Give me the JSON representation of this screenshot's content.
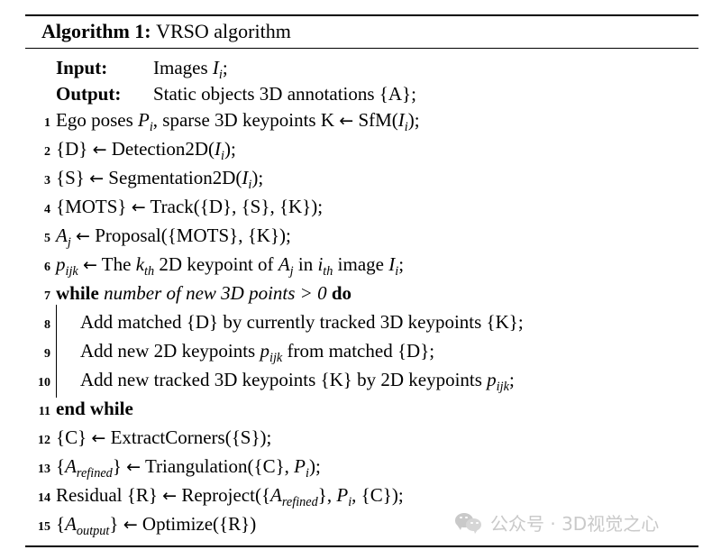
{
  "algorithm": {
    "caption_label": "Algorithm 1:",
    "caption_title": "VRSO algorithm",
    "io": [
      {
        "key": "Input:",
        "text_parts": [
          "Images ",
          "I",
          "i",
          ";"
        ]
      },
      {
        "key": "Output:",
        "text": "Static objects 3D annotations {A};"
      }
    ],
    "input_label": "Input:",
    "input_value": "Images Iᵢ;",
    "output_label": "Output:",
    "output_value": "Static objects 3D annotations {A};",
    "lines": [
      {
        "no": "1",
        "text": "Ego poses Pᵢ, sparse 3D keypoints K ← SfM(Iᵢ);"
      },
      {
        "no": "2",
        "text": "{D} ← Detection2D(Iᵢ);"
      },
      {
        "no": "3",
        "text": "{S} ← Segmentation2D(Iᵢ);"
      },
      {
        "no": "4",
        "text": "{MOTS} ← Track({D}, {S}, {K});"
      },
      {
        "no": "5",
        "text": "Aⱼ ← Proposal({MOTS}, {K});"
      },
      {
        "no": "6",
        "text": "pᵢⱼₖ ← The kₜₕ 2D keypoint of Aⱼ in iₜₕ image Iᵢ;"
      },
      {
        "no": "7",
        "text": "while number of new 3D points > 0 do"
      },
      {
        "no": "8",
        "text": "Add matched {D} by currently tracked 3D keypoints {K};"
      },
      {
        "no": "9",
        "text": "Add new 2D keypoints pᵢⱼₖ from matched {D};"
      },
      {
        "no": "10",
        "text": "Add new tracked 3D keypoints {K} by 2D keypoints pᵢⱼₖ;"
      },
      {
        "no": "11",
        "text": "end while"
      },
      {
        "no": "12",
        "text": "{C} ← ExtractCorners({S});"
      },
      {
        "no": "13",
        "text": "{Aᵣₑғᵢₙₑᵈ} ← Triangulation({C}, Pᵢ);"
      },
      {
        "no": "14",
        "text": "Residual {R} ← Reproject({Aᵣₑғᵢₙₑᵈ}, Pᵢ, {C});"
      },
      {
        "no": "15",
        "text": "{Aₒᵤₜₚᵤₜ} ← Optimize({R})"
      }
    ],
    "tokens": {
      "n1": "1",
      "n2": "2",
      "n3": "3",
      "n4": "4",
      "n5": "5",
      "n6": "6",
      "n7": "7",
      "n8": "8",
      "n9": "9",
      "n10": "10",
      "n11": "11",
      "n12": "12",
      "n13": "13",
      "n14": "14",
      "n15": "15",
      "arrow": "←",
      "ego_poses": "Ego poses ",
      "sparse_kp": ", sparse 3D keypoints K ",
      "sfm": " SfM(",
      "semi": ");",
      "brace_D": "{D} ",
      "detection2d": " Detection2D(",
      "brace_S": "{S} ",
      "segmentation2d": " Segmentation2D(",
      "brace_MOTS": "{MOTS} ",
      "track": " Track({D}, {S}, {K});",
      "proposal": " Proposal({MOTS}, {K});",
      "the": " The ",
      "kth_2d": " 2D keypoint of ",
      "in": " in ",
      "image": " image ",
      "semicolon": ";",
      "while_kw": "while",
      "while_cond": "number of new 3D points > 0",
      "do_kw": "do",
      "line8": "Add matched {D} by currently tracked 3D keypoints {K};",
      "line9_a": "Add new 2D keypoints ",
      "line9_b": " from matched {D};",
      "line10_a": "Add new tracked 3D keypoints {K} by 2D keypoints ",
      "line10_b": ";",
      "end_while": "end while",
      "brace_C": "{C} ",
      "extract_corners": " ExtractCorners({S});",
      "triangulation": " Triangulation({C}, ",
      "residual": "Residual {R} ",
      "reproject": " Reproject({",
      "reproject_tail": "}, ",
      "reproject_end": ", {C});",
      "optimize": " Optimize({R})",
      "sub_i": "i",
      "sub_j": "j",
      "sub_ijk": "ijk",
      "sub_th": "th",
      "sub_refined": "refined",
      "sub_output": "output",
      "var_P": "P",
      "var_I": "I",
      "var_A": "A",
      "var_p": "p",
      "var_k": "k",
      "brace_open": "{",
      "brace_close": "}"
    }
  },
  "watermark": {
    "icon": "wechat-icon",
    "text": "公众号 · 3D视觉之心"
  },
  "colors": {
    "text": "#000000",
    "rule": "#000000",
    "watermark": "#c9c9c9",
    "background": "#ffffff"
  }
}
